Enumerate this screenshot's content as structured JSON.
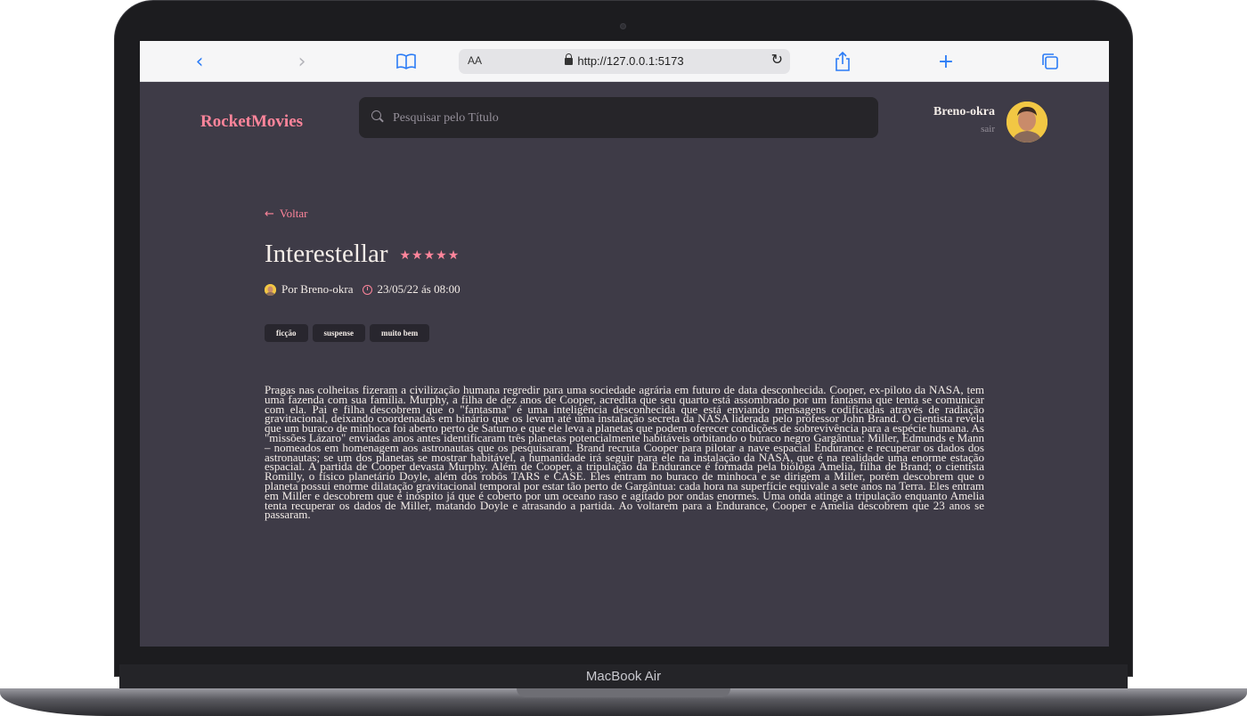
{
  "browser": {
    "text_size_label": "AA",
    "url": "http://127.0.0.1:5173"
  },
  "device": {
    "label": "MacBook Air"
  },
  "header": {
    "brand": "RocketMovies",
    "search_placeholder": "Pesquisar pelo Título",
    "user_name": "Breno-okra",
    "logout_label": "sair"
  },
  "movie": {
    "back_label": "Voltar",
    "title": "Interestellar",
    "rating": 5,
    "rating_display": "★★★★★",
    "author": "Por Breno-okra",
    "datetime": "23/05/22 ás 08:00",
    "tags": [
      "ficção",
      "suspense",
      "muito bem"
    ],
    "description": "Pragas nas colheitas fizeram a civilização humana regredir para uma sociedade agrária em futuro de data desconhecida. Cooper, ex-piloto da NASA, tem uma fazenda com sua família. Murphy, a filha de dez anos de Cooper, acredita que seu quarto está assombrado por um fantasma que tenta se comunicar com ela. Pai e filha descobrem que o \"fantasma\" é uma inteligência desconhecida que está enviando mensagens codificadas através de radiação gravitacional, deixando coordenadas em binário que os levam até uma instalação secreta da NASA liderada pelo professor John Brand. O cientista revela que um buraco de minhoca foi aberto perto de Saturno e que ele leva a planetas que podem oferecer condições de sobrevivência para a espécie humana. As \"missões Lázaro\" enviadas anos antes identificaram três planetas potencialmente habitáveis orbitando o buraco negro Gargântua: Miller, Edmunds e Mann – nomeados em homenagem aos astronautas que os pesquisaram. Brand recruta Cooper para pilotar a nave espacial Endurance e recuperar os dados dos astronautas; se um dos planetas se mostrar habitável, a humanidade irá seguir para ele na instalação da NASA, que é na realidade uma enorme estação espacial. A partida de Cooper devasta Murphy. Além de Cooper, a tripulação da Endurance é formada pela bióloga Amelia, filha de Brand; o cientista Romilly, o físico planetário Doyle, além dos robôs TARS e CASE. Eles entram no buraco de minhoca e se dirigem a Miller, porém descobrem que o planeta possui enorme dilatação gravitacional temporal por estar tão perto de Gargântua: cada hora na superfície equivale a sete anos na Terra. Eles entram em Miller e descobrem que é inóspito já que é coberto por um oceano raso e agitado por ondas enormes. Uma onda atinge a tripulação enquanto Amelia tenta recuperar os dados de Miller, matando Doyle e atrasando a partida. Ao voltarem para a Endurance, Cooper e Amelia descobrem que 23 anos se passaram."
  },
  "colors": {
    "accent": "#ff859b",
    "background": "#3e3b47",
    "input_bg": "#262529",
    "tag_bg": "#28262e"
  }
}
